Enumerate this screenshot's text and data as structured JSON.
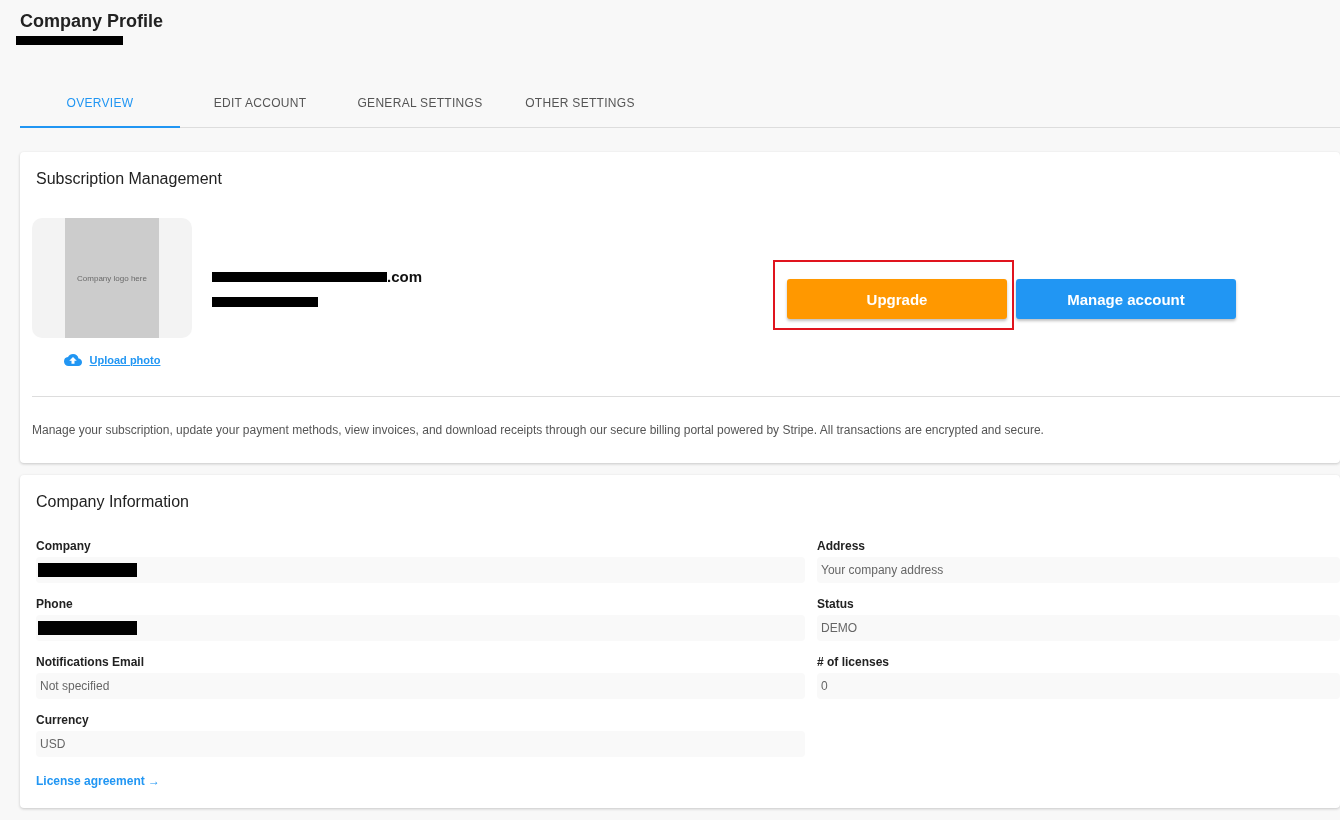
{
  "page": {
    "title": "Company Profile",
    "subtitle": {
      "redacted": true
    }
  },
  "tabs": [
    {
      "label": "OVERVIEW",
      "selected": true
    },
    {
      "label": "EDIT ACCOUNT",
      "selected": false
    },
    {
      "label": "GENERAL SETTINGS",
      "selected": false
    },
    {
      "label": "OTHER SETTINGS",
      "selected": false
    }
  ],
  "subscription": {
    "title": "Subscription Management",
    "logo_placeholder": "Company logo here",
    "upload_link": "Upload photo",
    "email": {
      "redacted": true,
      "visible_text": ".com"
    },
    "company_name": {
      "redacted": true
    },
    "buttons": [
      {
        "label": "Upgrade",
        "kind": "upgrade",
        "highlighted": true
      },
      {
        "label": "Manage account",
        "kind": "manage",
        "highlighted": false
      }
    ],
    "note": "Manage your subscription, update your payment methods, view invoices, and download receipts through our secure billing portal powered by Stripe. All transactions are encrypted and secure."
  },
  "company_info": {
    "title": "Company Information",
    "left_fields": [
      {
        "label": "Company",
        "redacted": true
      },
      {
        "label": "Phone",
        "redacted": true
      },
      {
        "label": "Notifications Email",
        "value": "Not specified"
      },
      {
        "label": "Currency",
        "value": "USD"
      }
    ],
    "right_fields": [
      {
        "label": "Address",
        "value": "Your company address"
      },
      {
        "label": "Status",
        "value": "DEMO"
      },
      {
        "label": "# of licenses",
        "value": "0"
      }
    ],
    "license_link": "License agreement →"
  }
}
